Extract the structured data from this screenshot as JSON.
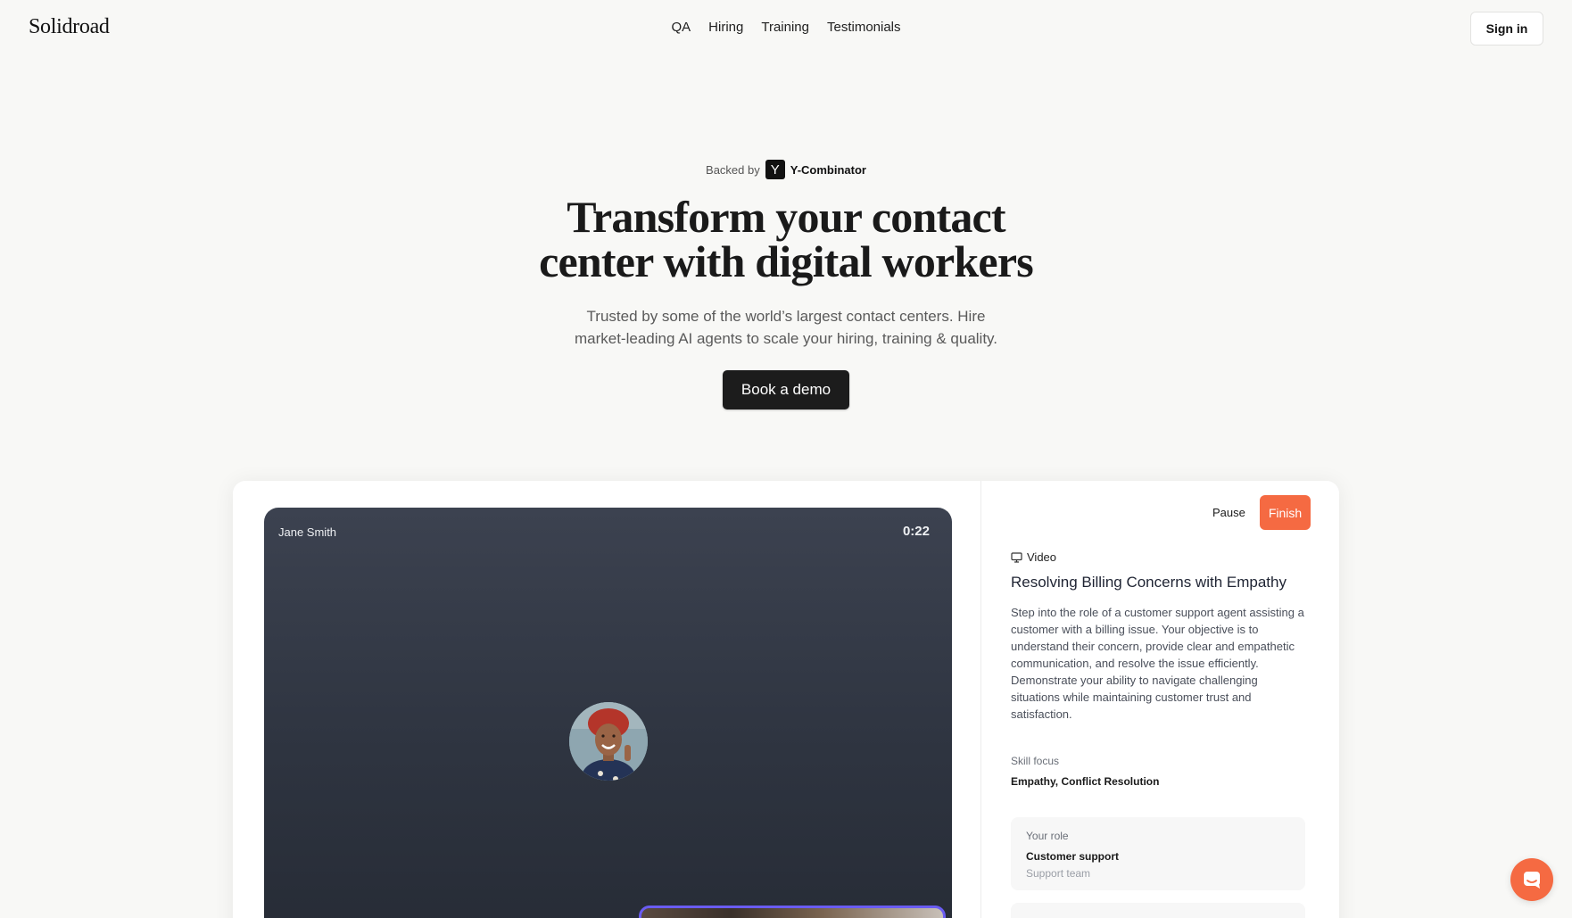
{
  "header": {
    "logo": "Solidroad",
    "nav": [
      "QA",
      "Hiring",
      "Training",
      "Testimonials"
    ],
    "signin_label": "Sign in"
  },
  "hero": {
    "backed_by": "Backed by",
    "yc_letter": "Y",
    "yc_name": "Y-Combinator",
    "title_line1": "Transform your contact",
    "title_line2": "center with digital workers",
    "subtitle_line1": "Trusted by some of the world’s largest contact centers. Hire",
    "subtitle_line2": "market-leading AI agents to scale your hiring, training & quality.",
    "cta_label": "Book a demo"
  },
  "demo": {
    "participant_name": "Jane Smith",
    "timer": "0:22",
    "pause_label": "Pause",
    "finish_label": "Finish",
    "media_type": "Video",
    "media_icon": "monitor-icon",
    "scenario_title": "Resolving Billing Concerns with Empathy",
    "scenario_description": "Step into the role of a customer support agent assisting a customer with a billing issue. Your objective is to understand their concern, provide clear and empathetic communication, and resolve the issue efficiently. Demonstrate your ability to navigate challenging situations while maintaining customer trust and satisfaction.",
    "skill_focus_label": "Skill focus",
    "skill_focus_value": "Empathy, Conflict Resolution",
    "role_label": "Your role",
    "role_value": "Customer support",
    "role_team": "Support team"
  },
  "colors": {
    "accent": "#f56a42",
    "cta_bg": "#1c1c1c",
    "video_bg": "#2e3440",
    "self_view_border": "#6a5cf2",
    "page_bg": "#f8f8f6"
  },
  "chat_launcher": {
    "icon": "chat-bubble-icon"
  }
}
